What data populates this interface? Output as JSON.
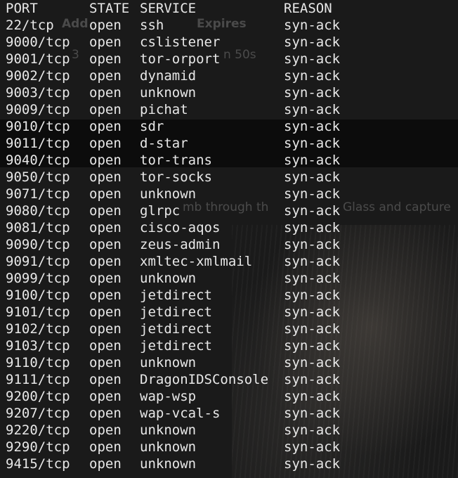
{
  "background": {
    "overlay_texts": [
      "Add",
      "Expires",
      "3",
      "n 50s",
      "mb through th",
      "Glass and capture"
    ]
  },
  "scan": {
    "headers": {
      "port": "PORT",
      "state": "STATE",
      "service": "SERVICE",
      "reason": "REASON"
    },
    "rows": [
      {
        "port": "22/tcp",
        "state": "open",
        "service": "ssh",
        "reason": "syn-ack"
      },
      {
        "port": "9000/tcp",
        "state": "open",
        "service": "cslistener",
        "reason": "syn-ack"
      },
      {
        "port": "9001/tcp",
        "state": "open",
        "service": "tor-orport",
        "reason": "syn-ack"
      },
      {
        "port": "9002/tcp",
        "state": "open",
        "service": "dynamid",
        "reason": "syn-ack"
      },
      {
        "port": "9003/tcp",
        "state": "open",
        "service": "unknown",
        "reason": "syn-ack"
      },
      {
        "port": "9009/tcp",
        "state": "open",
        "service": "pichat",
        "reason": "syn-ack"
      },
      {
        "port": "9010/tcp",
        "state": "open",
        "service": "sdr",
        "reason": "syn-ack"
      },
      {
        "port": "9011/tcp",
        "state": "open",
        "service": "d-star",
        "reason": "syn-ack"
      },
      {
        "port": "9040/tcp",
        "state": "open",
        "service": "tor-trans",
        "reason": "syn-ack"
      },
      {
        "port": "9050/tcp",
        "state": "open",
        "service": "tor-socks",
        "reason": "syn-ack"
      },
      {
        "port": "9071/tcp",
        "state": "open",
        "service": "unknown",
        "reason": "syn-ack"
      },
      {
        "port": "9080/tcp",
        "state": "open",
        "service": "glrpc",
        "reason": "syn-ack"
      },
      {
        "port": "9081/tcp",
        "state": "open",
        "service": "cisco-aqos",
        "reason": "syn-ack"
      },
      {
        "port": "9090/tcp",
        "state": "open",
        "service": "zeus-admin",
        "reason": "syn-ack"
      },
      {
        "port": "9091/tcp",
        "state": "open",
        "service": "xmltec-xmlmail",
        "reason": "syn-ack"
      },
      {
        "port": "9099/tcp",
        "state": "open",
        "service": "unknown",
        "reason": "syn-ack"
      },
      {
        "port": "9100/tcp",
        "state": "open",
        "service": "jetdirect",
        "reason": "syn-ack"
      },
      {
        "port": "9101/tcp",
        "state": "open",
        "service": "jetdirect",
        "reason": "syn-ack"
      },
      {
        "port": "9102/tcp",
        "state": "open",
        "service": "jetdirect",
        "reason": "syn-ack"
      },
      {
        "port": "9103/tcp",
        "state": "open",
        "service": "jetdirect",
        "reason": "syn-ack"
      },
      {
        "port": "9110/tcp",
        "state": "open",
        "service": "unknown",
        "reason": "syn-ack"
      },
      {
        "port": "9111/tcp",
        "state": "open",
        "service": "DragonIDSConsole",
        "reason": "syn-ack"
      },
      {
        "port": "9200/tcp",
        "state": "open",
        "service": "wap-wsp",
        "reason": "syn-ack"
      },
      {
        "port": "9207/tcp",
        "state": "open",
        "service": "wap-vcal-s",
        "reason": "syn-ack"
      },
      {
        "port": "9220/tcp",
        "state": "open",
        "service": "unknown",
        "reason": "syn-ack"
      },
      {
        "port": "9290/tcp",
        "state": "open",
        "service": "unknown",
        "reason": "syn-ack"
      },
      {
        "port": "9415/tcp",
        "state": "open",
        "service": "unknown",
        "reason": "syn-ack"
      }
    ]
  }
}
